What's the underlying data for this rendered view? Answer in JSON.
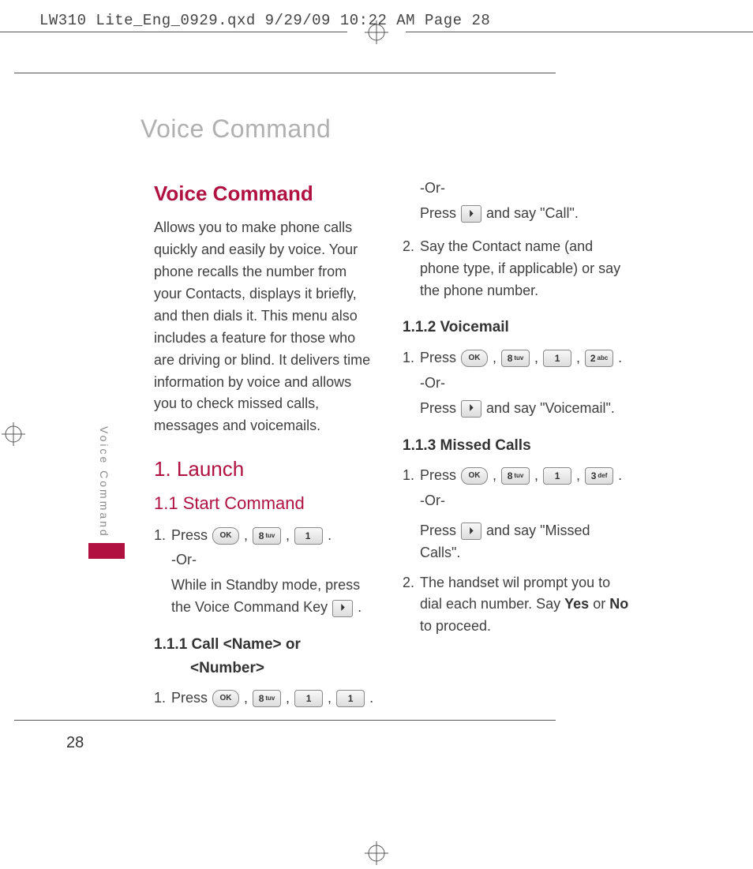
{
  "header": "LW310 Lite_Eng_0929.qxd  9/29/09  10:22 AM  Page 28",
  "page_title": "Voice Command",
  "side_tab": "Voice Command",
  "page_number": "28",
  "keys": {
    "ok": "OK",
    "k1": {
      "d": "1",
      "s": ""
    },
    "k2": {
      "d": "2",
      "s": "abc"
    },
    "k3": {
      "d": "3",
      "s": "def"
    },
    "k8": {
      "d": "8",
      "s": "tuv"
    },
    "voice": "⏵"
  },
  "left": {
    "h1": "Voice Command",
    "intro": "Allows you to make phone calls quickly and easily by voice. Your phone recalls the number from your Contacts, displays it briefly, and then dials it. This menu also includes a feature for those who are driving or blind. It delivers time information by voice and allows you to check missed calls, messages and voicemails.",
    "h2": "1. Launch",
    "h3": "1.1 Start Command",
    "s1_num": "1.",
    "s1_press": "Press ",
    "s1_dot": " .",
    "or": "-Or-",
    "s1b_a": "While in Standby mode, press the Voice Command Key ",
    "s1b_b": " .",
    "h4": "1.1.1 Call <Name> or",
    "h4b": "<Number>",
    "s2_num": "1.",
    "s2_press": "Press ",
    "s2_dot": " ."
  },
  "right": {
    "or": "-Or-",
    "r1a": "Press ",
    "r1b": " and say \"Call\".",
    "r2_num": "2.",
    "r2": "Say the Contact name (and phone type, if applicable) or say the phone number.",
    "h_vm": "1.1.2 Voicemail",
    "vm_num": "1.",
    "vm_press": "Press ",
    "vm_dot": " .",
    "vm_b": " and say \"Voicemail\".",
    "h_mc": "1.1.3 Missed Calls",
    "mc_num": "1.",
    "mc_press": "Press ",
    "mc_dot": " .",
    "mc_b_a": " and say \"Missed Calls\".",
    "mc2_num": "2.",
    "mc2_a": "The handset wil prompt you to dial each number. Say ",
    "yes": "Yes",
    "mc2_b": " or ",
    "no": "No",
    "mc2_c": " to proceed."
  }
}
